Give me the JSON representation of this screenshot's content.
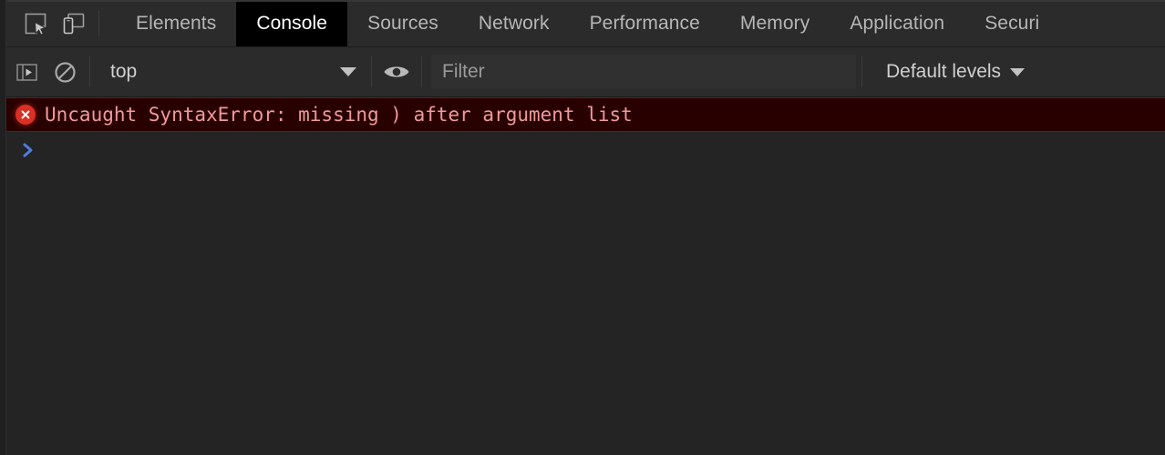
{
  "window": {
    "app": "Chrome DevTools",
    "theme": "dark",
    "background_color": "#242424"
  },
  "main_toolbar": {
    "icons": [
      {
        "name": "inspect-element-icon",
        "title": "Inspect element"
      },
      {
        "name": "device-toolbar-icon",
        "title": "Toggle device toolbar"
      }
    ],
    "tabs": [
      {
        "label": "Elements",
        "active": false
      },
      {
        "label": "Console",
        "active": true
      },
      {
        "label": "Sources",
        "active": false
      },
      {
        "label": "Network",
        "active": false
      },
      {
        "label": "Performance",
        "active": false
      },
      {
        "label": "Memory",
        "active": false
      },
      {
        "label": "Application",
        "active": false
      },
      {
        "label": "Securi",
        "active": false
      }
    ],
    "active_tab": "Console",
    "active_tab_bg": "#000000",
    "active_tab_color": "#ffffff",
    "inactive_tab_color": "#b6b6b6"
  },
  "console_toolbar": {
    "sidebar_toggle": {
      "name": "console-sidebar-icon",
      "title": "Show console sidebar"
    },
    "clear_console": {
      "name": "clear-console-icon",
      "title": "Clear console"
    },
    "context_selector": {
      "value": "top",
      "caret": "▼"
    },
    "live_expression": {
      "name": "eye-icon",
      "title": "Create live expression"
    },
    "filter": {
      "placeholder": "Filter",
      "value": ""
    },
    "levels_selector": {
      "label": "Default levels",
      "caret": "▼"
    }
  },
  "console_output": {
    "messages": [
      {
        "level": "error",
        "icon": "error-circle-x-icon",
        "text": "Uncaught SyntaxError: missing ) after argument list",
        "text_color": "#ef9a9a",
        "background_color": "#290000",
        "border_color": "#5c2020"
      }
    ],
    "prompt": {
      "chevron": "❯",
      "chevron_color": "#4a7fe0",
      "value": ""
    }
  }
}
